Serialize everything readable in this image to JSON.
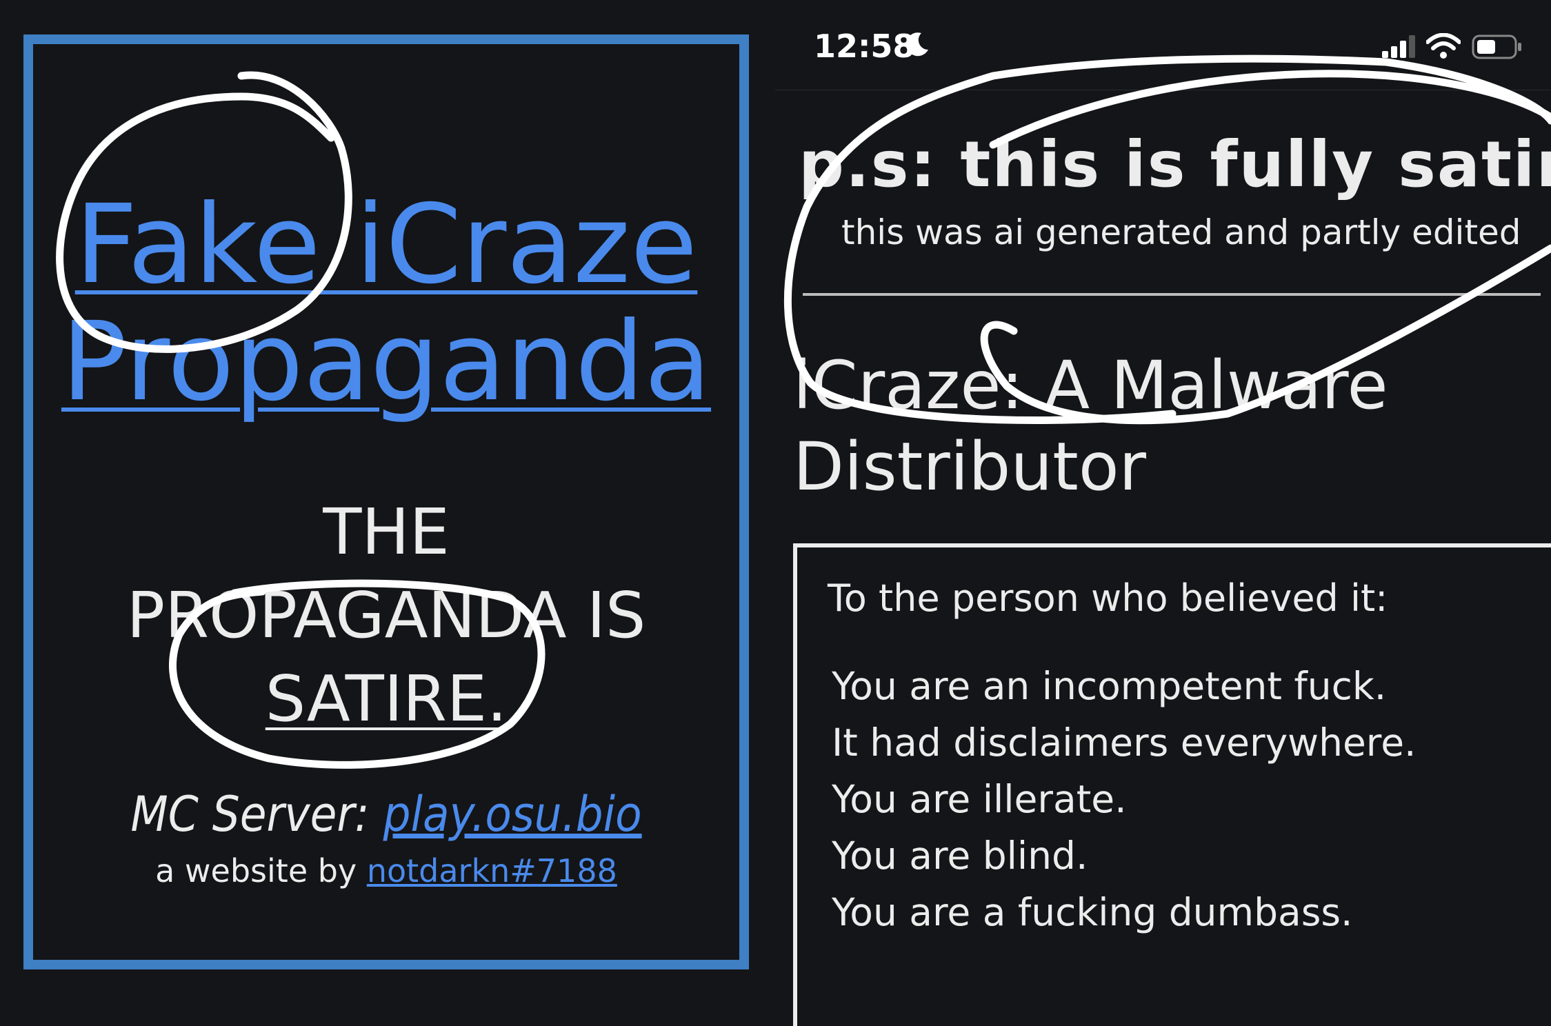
{
  "left_panel": {
    "title_line_1": "Fake iCraze",
    "title_line_2": "Propaganda",
    "statement_line_1": "THE",
    "statement_line_2": "PROPAGANDA IS",
    "statement_line_3": "SATIRE.",
    "mc_label": "MC Server: ",
    "mc_link": "play.osu.bio",
    "credit_label": "a website by ",
    "credit_link": "notdarkn#7188"
  },
  "status_bar": {
    "time": "12:58"
  },
  "right_panel": {
    "ps_heading": "p.s: this is fully satire",
    "ps_sub": "this was ai generated and partly edited",
    "article_title": "iCraze: A Malware Distributor",
    "message_heading": "To the person who believed it:",
    "message_lines": [
      "You are an incompetent fuck.",
      "It had disclaimers everywhere.",
      "You are illerate.",
      "You are blind.",
      "You are a fucking dumbass."
    ]
  },
  "colors": {
    "background": "#141518",
    "frame_blue": "#3f7fc4",
    "link_blue": "#4a8aec",
    "text": "#ececec",
    "annotation": "#ffffff"
  }
}
